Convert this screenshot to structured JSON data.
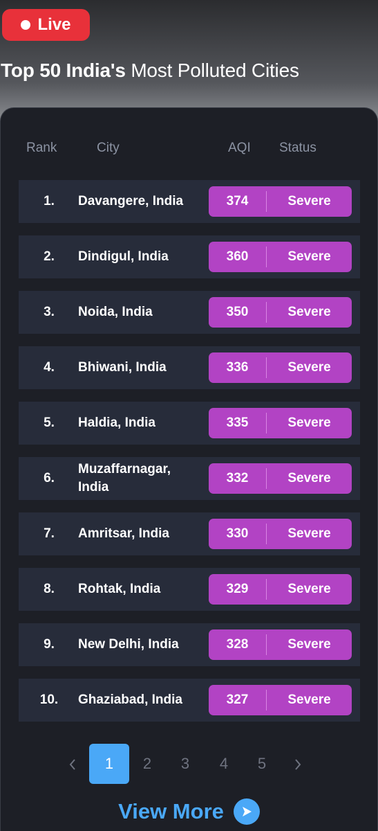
{
  "live_label": "Live",
  "title": {
    "bold": "Top 50 India's",
    "light": "Most Polluted Cities"
  },
  "headers": {
    "rank": "Rank",
    "city": "City",
    "aqi": "AQI",
    "status": "Status"
  },
  "rows": [
    {
      "rank": "1.",
      "city": "Davangere, India",
      "aqi": "374",
      "status": "Severe"
    },
    {
      "rank": "2.",
      "city": "Dindigul, India",
      "aqi": "360",
      "status": "Severe"
    },
    {
      "rank": "3.",
      "city": "Noida, India",
      "aqi": "350",
      "status": "Severe"
    },
    {
      "rank": "4.",
      "city": "Bhiwani, India",
      "aqi": "336",
      "status": "Severe"
    },
    {
      "rank": "5.",
      "city": "Haldia, India",
      "aqi": "335",
      "status": "Severe"
    },
    {
      "rank": "6.",
      "city": "Muzaffarnagar, India",
      "aqi": "332",
      "status": "Severe"
    },
    {
      "rank": "7.",
      "city": "Amritsar, India",
      "aqi": "330",
      "status": "Severe"
    },
    {
      "rank": "8.",
      "city": "Rohtak, India",
      "aqi": "329",
      "status": "Severe"
    },
    {
      "rank": "9.",
      "city": "New Delhi, India",
      "aqi": "328",
      "status": "Severe"
    },
    {
      "rank": "10.",
      "city": "Ghaziabad, India",
      "aqi": "327",
      "status": "Severe"
    }
  ],
  "pagination": {
    "pages": [
      "1",
      "2",
      "3",
      "4",
      "5"
    ],
    "current": "1",
    "prev_icon": "chevron-left-icon",
    "next_icon": "chevron-right-icon"
  },
  "view_more": {
    "label": "View More",
    "icon": "arrow-right-circle-icon"
  },
  "colors": {
    "severe": "#b243c4",
    "accent": "#4aa8f7",
    "live": "#e8313a"
  }
}
